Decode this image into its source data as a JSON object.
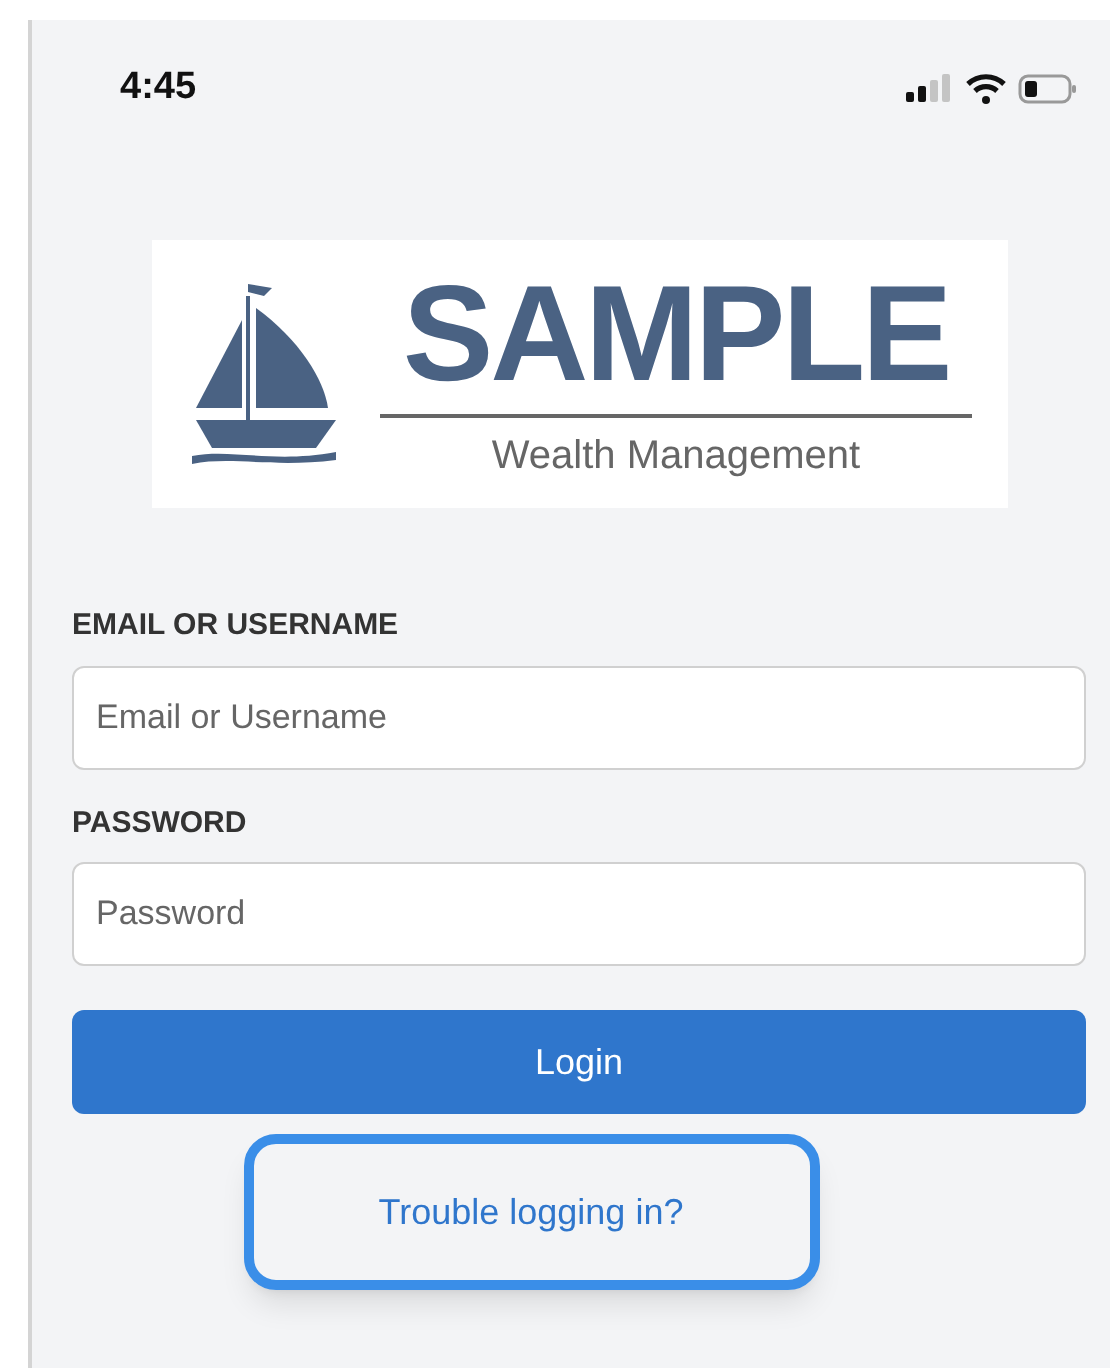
{
  "status_bar": {
    "time": "4:45"
  },
  "logo": {
    "name": "SAMPLE",
    "tagline": "Wealth Management"
  },
  "fields": [
    {
      "label": "EMAIL OR USERNAME",
      "placeholder": "Email or Username"
    },
    {
      "label": "PASSWORD",
      "placeholder": "Password"
    }
  ],
  "login_button": "Login",
  "help_link": {
    "label": "Trouble logging in?",
    "highlighted": true
  }
}
